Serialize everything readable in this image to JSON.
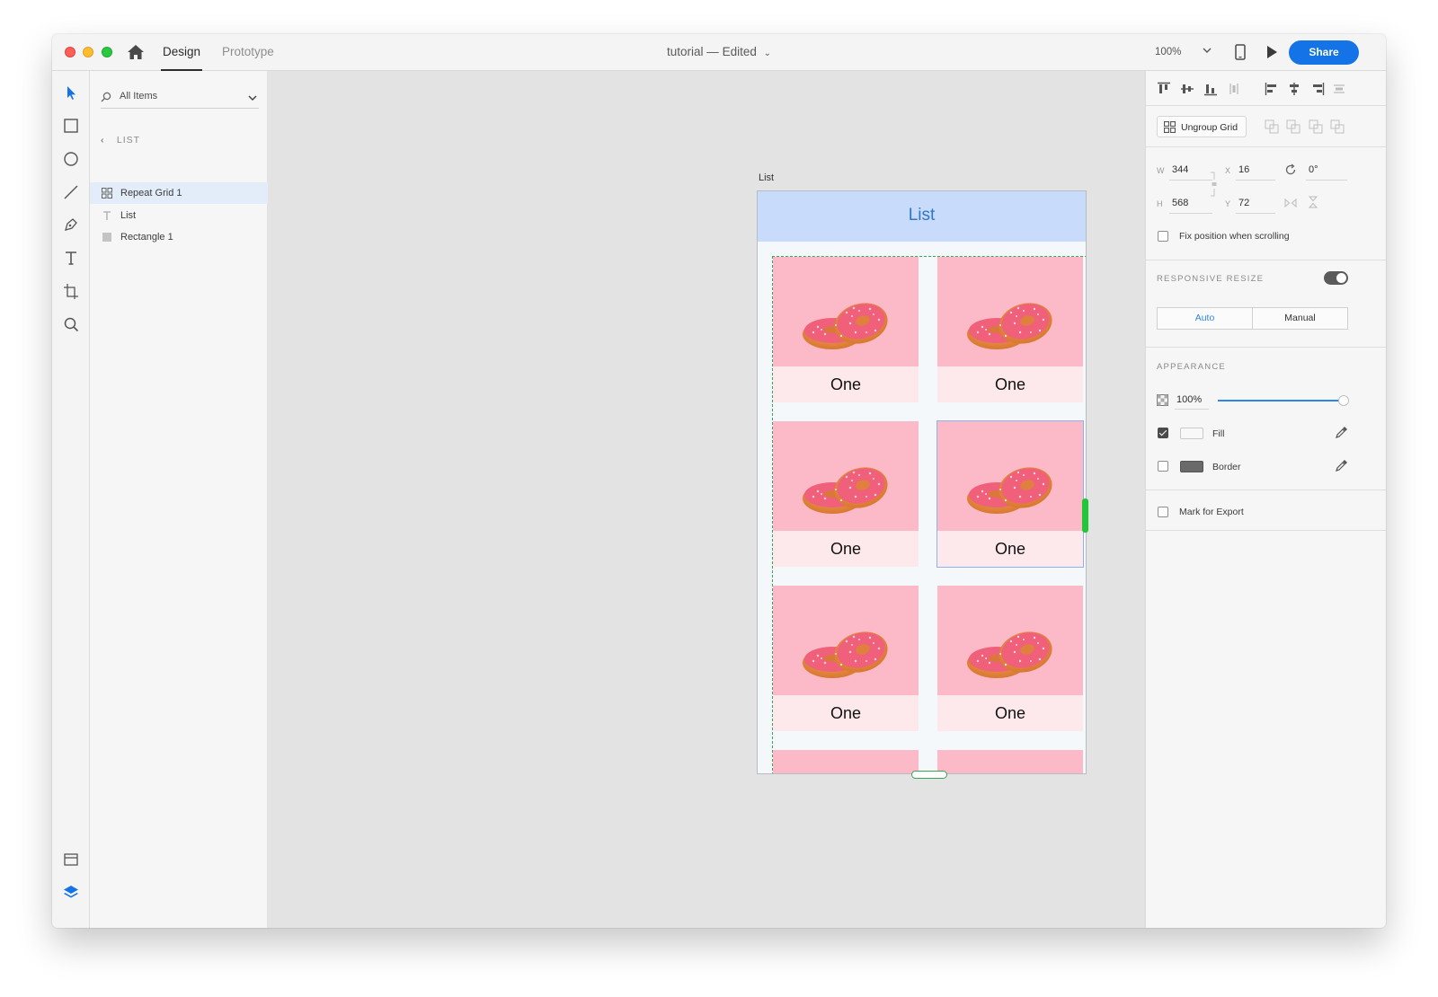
{
  "titlebar": {
    "tabs": [
      {
        "label": "Design"
      },
      {
        "label": "Prototype"
      }
    ],
    "doc_name": "tutorial",
    "separator": "—",
    "doc_state": "Edited",
    "zoom": "100%",
    "share_label": "Share"
  },
  "layers": {
    "search_label": "All Items",
    "back_label": "LIST",
    "items": [
      {
        "label": "Repeat Grid 1",
        "icon": "grid-icon",
        "selected": true
      },
      {
        "label": "List",
        "icon": "text-icon",
        "selected": false
      },
      {
        "label": "Rectangle 1",
        "icon": "rectangle-icon",
        "selected": false
      }
    ]
  },
  "canvas": {
    "artboard_label": "List",
    "header_title": "List",
    "cards": [
      {
        "caption": "One"
      },
      {
        "caption": "One"
      },
      {
        "caption": "One"
      },
      {
        "caption": "One"
      },
      {
        "caption": "One"
      },
      {
        "caption": "One"
      }
    ],
    "colors": {
      "header": "#c9dbfb",
      "card_image": "#fcb9c7",
      "card_caption": "#fde9ec",
      "selection": "#21c63a"
    }
  },
  "props": {
    "ungroup_label": "Ungroup Grid",
    "w_label": "W",
    "w_value": "344",
    "x_label": "X",
    "x_value": "16",
    "h_label": "H",
    "h_value": "568",
    "y_label": "Y",
    "y_value": "72",
    "rotation": "0°",
    "fix_position_label": "Fix position when scrolling",
    "responsive_resize_label": "RESPONSIVE RESIZE",
    "auto_label": "Auto",
    "manual_label": "Manual",
    "appearance_label": "APPEARANCE",
    "opacity": "100%",
    "fill_label": "Fill",
    "border_label": "Border",
    "export_label": "Mark for Export",
    "accent": "#1473e6"
  }
}
